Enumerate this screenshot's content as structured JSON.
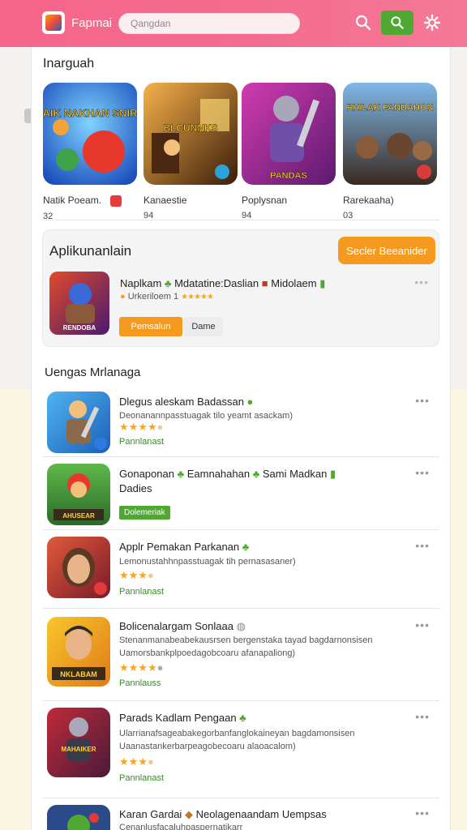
{
  "colors": {
    "accent": "#f7658c",
    "orange": "#f59a1f",
    "green": "#4ea832",
    "star": "#f5a623"
  },
  "header": {
    "title": "Fapmai",
    "search_placeholder": "Qangdan",
    "icons": [
      "logo-icon",
      "search-icon",
      "search-button-icon",
      "gear-icon"
    ]
  },
  "featured": {
    "title": "Inarguah",
    "items": [
      {
        "name": "Natik Poeam.",
        "count": "32",
        "art_text": "SAIK NAKHAN SNIRS"
      },
      {
        "name": "Kanaestie",
        "count": "94",
        "art_text": "BLCUNNKS"
      },
      {
        "name": "Poplysnan",
        "count": "94",
        "art_text": "PANDAS"
      },
      {
        "name": "Rarekaaha)",
        "count": "03",
        "art_text": "RHILAK FANDAHON"
      }
    ]
  },
  "promo": {
    "title": "Aplikunanlain",
    "button": "Secler Beeanider",
    "line1": "Naplkam",
    "line1_b": "Mdatatine:Daslian",
    "line1_c": "Midolaem",
    "line2": "Urkeriloem 1",
    "stars": "★★★★★",
    "primary": "Pemsalun",
    "secondary": "Dame",
    "icon_text": "RENDOBA",
    "dots": "•••"
  },
  "list": {
    "title": "Uengas Mrlanaga",
    "items": [
      {
        "title": "Dlegus aleskam Badassan",
        "sub": "Deonanannpasstuagak tilo yeamt asackam)",
        "rating": 4,
        "tag": "Pannlanast",
        "dots": "•••"
      },
      {
        "title": "Gonaponan",
        "title_b": "Eamnahahan",
        "title_c": "Sami Madkan",
        "sub": "Dadies",
        "tag": "Dolemeriak",
        "icon_text": "AHUSEAR",
        "dots": "•••"
      },
      {
        "title": "Applr Pemakan Parkanan",
        "sub": "Lemonustahhnpasstuagak tih pernasasaner)",
        "rating": 3,
        "tag": "Pannlanast",
        "dots": "•••"
      },
      {
        "title": "Bolicenalargam Sonlaaa",
        "sub": "Stenanmanabeabekausrsen bergenstaka tayad bagdarnonsisen",
        "sub2": "Uamorsbankplpoedagobcoaru afanapaliong)",
        "rating": 4,
        "tag": "Pannlauss",
        "icon_text": "NKLABAM",
        "dots": "•••"
      },
      {
        "title": "Parads Kadlam Pengaan",
        "sub": "Ularrianafsageabakegorbanfanglokaineyan bagdamonsisen",
        "sub2": "Uaanastankerbarpeagobecoaru alaoacalom)",
        "rating": 3,
        "tag": "Pannlanast",
        "icon_text": "MAHAIKER",
        "dots": "•••"
      },
      {
        "title": "Karan Gardai",
        "title_b": "Neolagenaandam Uempsas",
        "sub": "Cenanlusfacaluhpaspernatikarr",
        "dots": "•••"
      }
    ]
  }
}
